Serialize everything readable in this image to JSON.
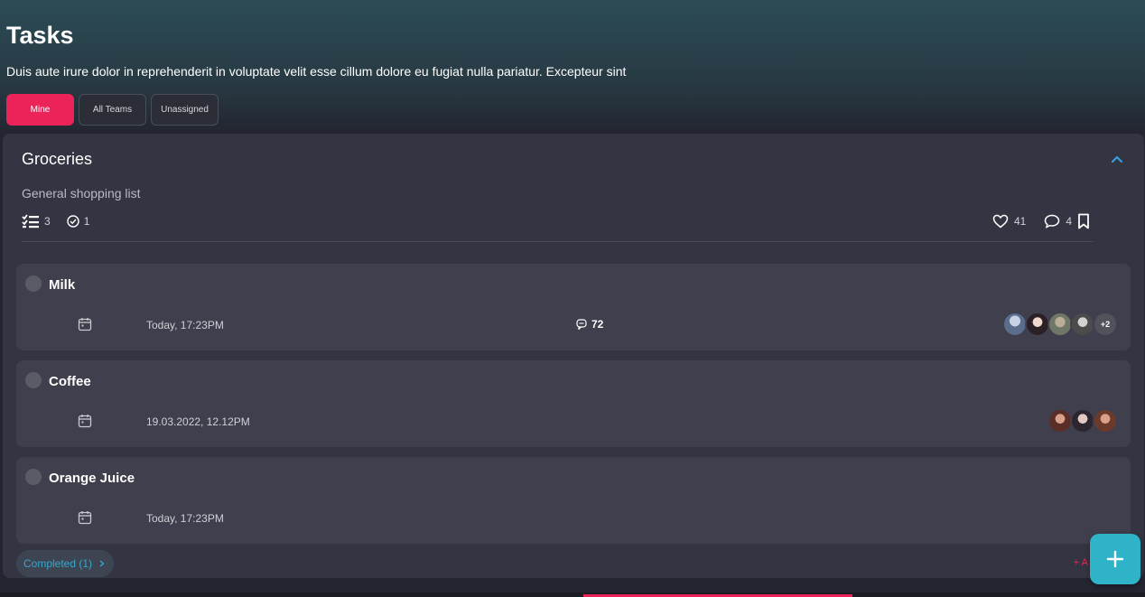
{
  "page": {
    "title": "Tasks",
    "description": "Duis aute irure dolor in reprehenderit in voluptate velit esse cillum dolore eu fugiat nulla pariatur. Excepteur sint"
  },
  "filters": [
    {
      "label": "Mine",
      "active": true
    },
    {
      "label": "All Teams",
      "active": false
    },
    {
      "label": "Unassigned",
      "active": false
    }
  ],
  "list": {
    "title": "Groceries",
    "subtitle": "General shopping list",
    "task_count": "3",
    "done_count": "1",
    "likes": "41",
    "comments": "4"
  },
  "tasks": [
    {
      "name": "Milk",
      "date": "Today, 17:23PM",
      "comments": "72",
      "avatar_count": 4,
      "more": "+2"
    },
    {
      "name": "Coffee",
      "date": "19.03.2022, 12.12PM",
      "comments": "",
      "avatar_count": 3,
      "more": ""
    },
    {
      "name": "Orange Juice",
      "date": "Today, 17:23PM",
      "comments": "",
      "avatar_count": 0,
      "more": ""
    }
  ],
  "footer": {
    "completed_label": "Completed (1)",
    "add_label": "+ A"
  },
  "colors": {
    "accent_pink": "#ec2359",
    "accent_teal": "#2eb3c8",
    "card_bg": "#343542",
    "task_bg": "#403f4d"
  },
  "icons": {
    "list": "checklist-icon",
    "done": "check-circle-icon",
    "like": "heart-icon",
    "comment": "comment-icon",
    "bookmark": "bookmark-icon",
    "collapse": "chevron-up-icon",
    "calendar": "calendar-icon",
    "add": "plus-icon"
  }
}
